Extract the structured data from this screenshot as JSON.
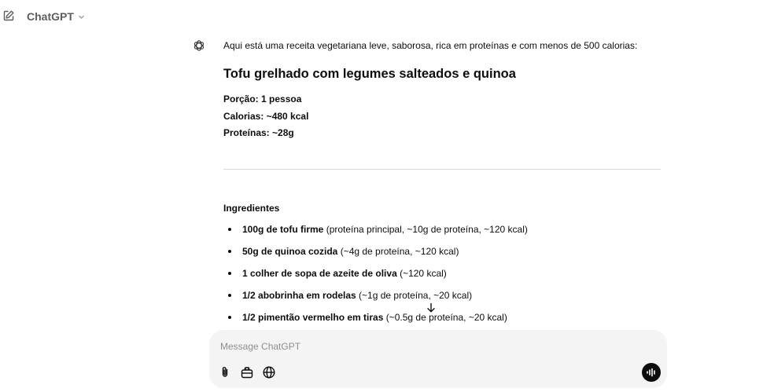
{
  "header": {
    "model_name": "ChatGPT"
  },
  "message": {
    "intro": "Aqui está uma receita vegetariana leve, saborosa, rica em proteínas e com menos de 500 calorias:",
    "title": "Tofu grelhado com legumes salteados e quinoa",
    "meta": [
      "Porção: 1 pessoa",
      "Calorias: ~480 kcal",
      "Proteínas: ~28g"
    ],
    "ingredients_heading": "Ingredientes",
    "ingredients": [
      {
        "bold": "100g de tofu firme",
        "rest": " (proteína principal, ~10g de proteína, ~120 kcal)"
      },
      {
        "bold": "50g de quinoa cozida",
        "rest": " (~4g de proteína, ~120 kcal)"
      },
      {
        "bold": "1 colher de sopa de azeite de oliva",
        "rest": " (~120 kcal)"
      },
      {
        "bold": "1/2 abobrinha em rodelas",
        "rest": " (~1g de proteína, ~20 kcal)"
      },
      {
        "bold": "1/2 pimentão vermelho em tiras",
        "rest": " (~0.5g de proteína, ~20 kcal)"
      }
    ]
  },
  "composer": {
    "placeholder": "Message ChatGPT"
  },
  "icons": {
    "new_chat": "edit-icon",
    "model_dropdown": "chevron-down-icon",
    "assistant": "openai-logo-icon",
    "scroll": "arrow-down-icon",
    "attach": "paperclip-icon",
    "tools": "toolbox-icon",
    "web": "globe-icon",
    "voice": "voice-waveform-icon"
  }
}
